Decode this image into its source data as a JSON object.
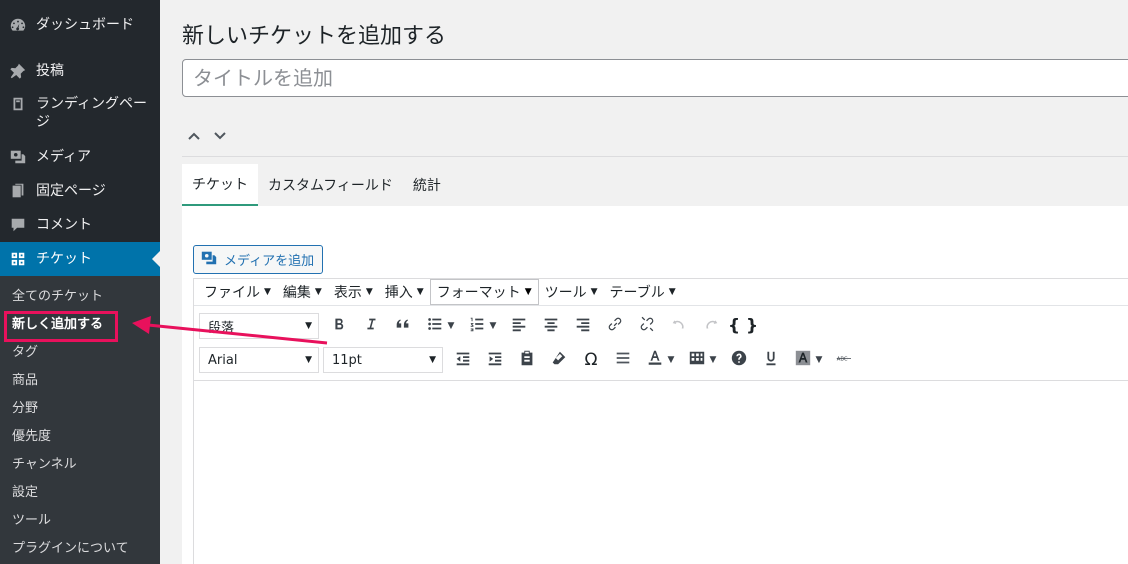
{
  "sidebar": {
    "items": [
      {
        "label": "ダッシュボード",
        "icon": "dashboard-icon"
      },
      {
        "label": "投稿",
        "icon": "pin-icon"
      },
      {
        "label": "ランディングページ",
        "icon": "page-icon"
      },
      {
        "label": "メディア",
        "icon": "media-icon"
      },
      {
        "label": "固定ページ",
        "icon": "pages-icon"
      },
      {
        "label": "コメント",
        "icon": "comment-icon"
      },
      {
        "label": "チケット",
        "icon": "grid-icon"
      }
    ],
    "submenu": [
      "全てのチケット",
      "新しく追加する",
      "タグ",
      "商品",
      "分野",
      "優先度",
      "チャンネル",
      "設定",
      "ツール",
      "プラグインについて"
    ],
    "accent_color": "#0073aa",
    "highlight_color": "#e8115c"
  },
  "main": {
    "page_title": "新しいチケットを追加する",
    "title_placeholder": "タイトルを追加",
    "tabs": [
      "チケット",
      "カスタムフィールド",
      "統計"
    ],
    "add_media_label": "メディアを追加"
  },
  "editor": {
    "menubar": [
      "ファイル",
      "編集",
      "表示",
      "挿入",
      "フォーマット",
      "ツール",
      "テーブル"
    ],
    "block_format": "段落",
    "font_family": "Arial",
    "font_size": "11pt"
  }
}
